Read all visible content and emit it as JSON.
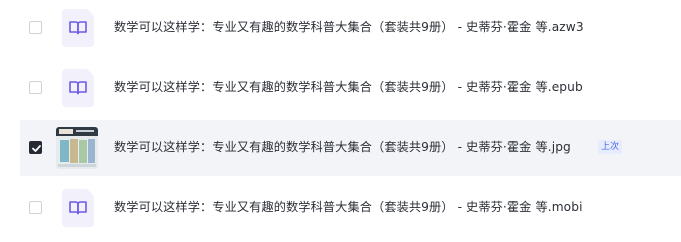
{
  "files": [
    {
      "name": "数学可以这样学：专业又有趣的数学科普大集合（套装共9册） - 史蒂芬·霍金 等.azw3",
      "checked": false,
      "icon": "ebook-file-icon"
    },
    {
      "name": "数学可以这样学：专业又有趣的数学科普大集合（套装共9册） - 史蒂芬·霍金 等.epub",
      "checked": false,
      "icon": "ebook-file-icon"
    },
    {
      "name": "数学可以这样学：专业又有趣的数学科普大集合（套装共9册） - 史蒂芬·霍金 等.jpg",
      "checked": true,
      "icon": "image-thumbnail",
      "badge": "上次"
    },
    {
      "name": "数学可以这样学：专业又有趣的数学科普大集合（套装共9册） - 史蒂芬·霍金 等.mobi",
      "checked": false,
      "icon": "ebook-file-icon"
    }
  ],
  "colors": {
    "selected_row_bg": "#f3f4f7",
    "checkbox_checked": "#262a33",
    "icon_tint": "#6b5ce7",
    "icon_bg": "#f1f0fb",
    "badge_text": "#4a67e6",
    "badge_bg": "#e6ecfd"
  }
}
